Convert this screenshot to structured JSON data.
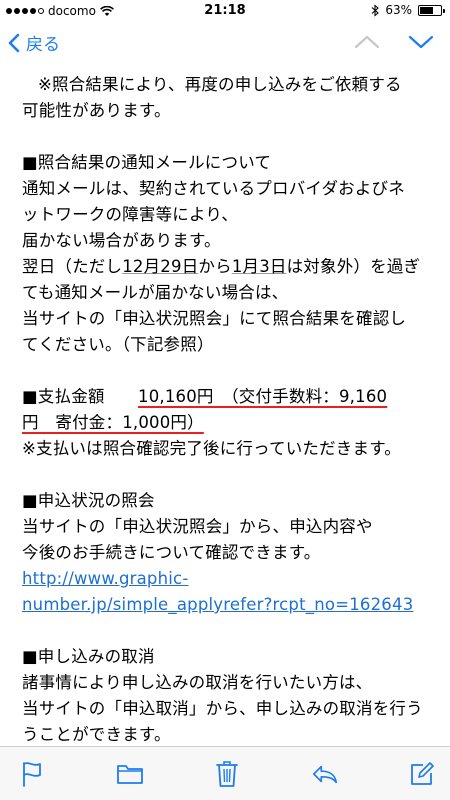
{
  "status": {
    "carrier": "docomo",
    "time": "21:18",
    "battery": "63%",
    "battery_level": 0.63
  },
  "nav": {
    "back_label": "戻る"
  },
  "body": {
    "p1": [
      "※照合結果により、再度の申し込みをご依頼する",
      "可能性があります。"
    ],
    "p2": [
      "■照合結果の通知メールについて",
      "通知メールは、契約されているプロバイダおよびネ",
      "ットワークの障害等により、",
      "届かない場合があります。"
    ],
    "p2b": {
      "a": "翌日（ただし",
      "b": "12月29日",
      "c": "から",
      "d": "1月3日",
      "e": "は対象外）を過ぎ"
    },
    "p2c": [
      "ても通知メールが届かない場合は、",
      "当サイトの「申込状況照会」にて照合結果を確認し",
      "てください。（下記参照）"
    ],
    "p3": {
      "line1_a": "■支払金額　　",
      "line1_b": "10,160円　（交付手数料：9,160",
      "line2": "円　寄付金：1,000円）",
      "line3": "※支払いは照合確認完了後に行っていただきます。"
    },
    "p4": [
      "■申込状況の照会",
      "当サイトの「申込状況照会」から、申込内容や",
      "今後のお手続きについて確認できます。"
    ],
    "link": [
      "http://www.graphic-",
      "number.jp/simple_applyrefer?rcpt_no=162643"
    ],
    "p5": [
      "■申し込みの取消",
      "諸事情により申し込みの取消を行いたい方は、",
      "当サイトの「申込取消」から、申し込みの取消を行う",
      "うことができます。"
    ]
  },
  "toolbar": {
    "items": [
      "flag-icon",
      "folder-icon",
      "trash-icon",
      "reply-icon",
      "compose-icon"
    ]
  },
  "colors": {
    "accent": "#1e7cf2",
    "link": "#1e6fd0",
    "underline_red": "#e82020"
  }
}
